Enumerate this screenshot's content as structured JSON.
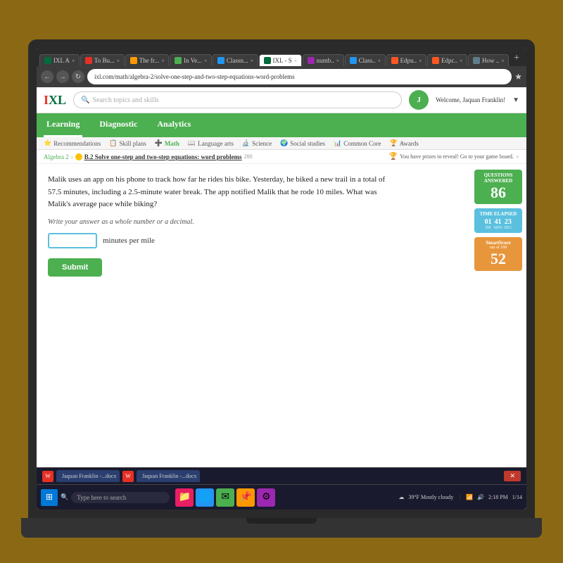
{
  "browser": {
    "tabs": [
      {
        "label": "IXL A",
        "active": false,
        "color": "#006b3c"
      },
      {
        "label": "To Bu...",
        "active": false,
        "color": "#e53025"
      },
      {
        "label": "The fr...",
        "active": false,
        "color": "#f90"
      },
      {
        "label": "In Ve...",
        "active": false,
        "color": "#4caf50"
      },
      {
        "label": "Classn...",
        "active": false,
        "color": "#2196f3"
      },
      {
        "label": "IXL - S",
        "active": true,
        "color": "#006b3c"
      },
      {
        "label": "numb..",
        "active": false,
        "color": "#9c27b0"
      },
      {
        "label": "Class..",
        "active": false,
        "color": "#2196f3"
      },
      {
        "label": "Edpu..",
        "active": false,
        "color": "#ff5722"
      },
      {
        "label": "Edpc..",
        "active": false,
        "color": "#ff5722"
      },
      {
        "label": "How ..",
        "active": false,
        "color": "#607d8b"
      }
    ],
    "address": "ixl.com/math/algebra-2/solve-one-step-and-two-step-equations-word-problems"
  },
  "ixl": {
    "logo_i": "I",
    "logo_xl": "XL",
    "search_placeholder": "Search topics and skills",
    "welcome_text": "Welcome, Jaquan Franklin!",
    "nav_items": [
      "Learning",
      "Diagnostic",
      "Analytics"
    ],
    "active_nav": "Learning",
    "subnav_items": [
      "Recommendations",
      "Skill plans",
      "Math",
      "Language arts",
      "Science",
      "Social studies",
      "Common Core",
      "Awards"
    ],
    "active_subnav": "Math",
    "breadcrumb": {
      "parent": "Algebra 2",
      "current": "B.2 Solve one-step and two-step equations: word problems",
      "number": "280"
    },
    "prize_text": "You have prizes to reveal! Go to your game board.",
    "question": {
      "text": "Malik uses an app on his phone to track how far he rides his bike. Yesterday, he biked a new trail in a total of 57.5 minutes, including a 2.5-minute water break. The app notified Malik that he rode 10 miles. What was Malik's average pace while biking?",
      "instruction": "Write your answer as a whole number or a decimal.",
      "input_placeholder": "",
      "unit_label": "minutes per mile",
      "submit_label": "Submit"
    },
    "scores": {
      "questions_label": "Questions answered",
      "questions_value": "86",
      "time_label": "Time elapsed",
      "time_hr": "01",
      "time_min": "41",
      "time_sec": "23",
      "time_hr_unit": "HR",
      "time_min_unit": "MIN",
      "time_sec_unit": "SEC",
      "smart_label": "SmartScore",
      "smart_sub": "out of 100",
      "smart_value": "52"
    }
  },
  "taskbar": {
    "search_placeholder": "Type here to search",
    "weather": "39°F  Mostly cloudy",
    "time": "2:18 PM",
    "date": "1/14",
    "open_files": [
      {
        "label": "Jaquan Franklin -...docx"
      },
      {
        "label": "Jaquan Franklin -...docx"
      }
    ]
  }
}
